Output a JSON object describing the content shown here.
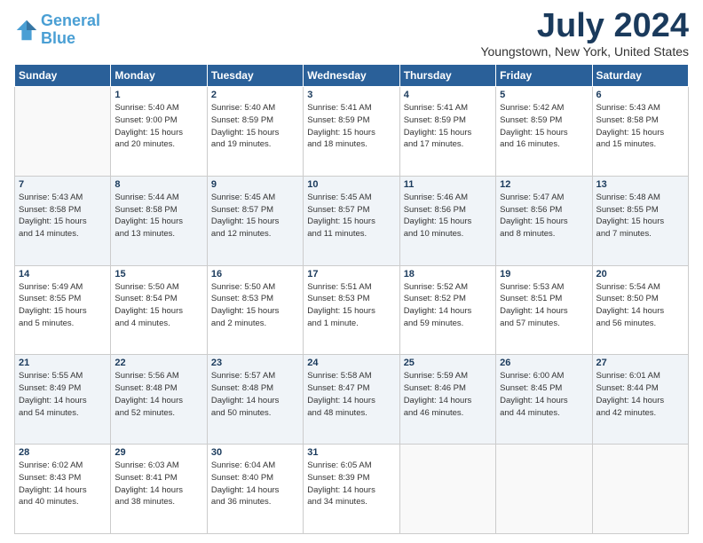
{
  "header": {
    "logo_line1": "General",
    "logo_line2": "Blue",
    "title": "July 2024",
    "location": "Youngstown, New York, United States"
  },
  "days_of_week": [
    "Sunday",
    "Monday",
    "Tuesday",
    "Wednesday",
    "Thursday",
    "Friday",
    "Saturday"
  ],
  "weeks": [
    [
      {
        "num": "",
        "info": ""
      },
      {
        "num": "1",
        "info": "Sunrise: 5:40 AM\nSunset: 9:00 PM\nDaylight: 15 hours\nand 20 minutes."
      },
      {
        "num": "2",
        "info": "Sunrise: 5:40 AM\nSunset: 8:59 PM\nDaylight: 15 hours\nand 19 minutes."
      },
      {
        "num": "3",
        "info": "Sunrise: 5:41 AM\nSunset: 8:59 PM\nDaylight: 15 hours\nand 18 minutes."
      },
      {
        "num": "4",
        "info": "Sunrise: 5:41 AM\nSunset: 8:59 PM\nDaylight: 15 hours\nand 17 minutes."
      },
      {
        "num": "5",
        "info": "Sunrise: 5:42 AM\nSunset: 8:59 PM\nDaylight: 15 hours\nand 16 minutes."
      },
      {
        "num": "6",
        "info": "Sunrise: 5:43 AM\nSunset: 8:58 PM\nDaylight: 15 hours\nand 15 minutes."
      }
    ],
    [
      {
        "num": "7",
        "info": "Sunrise: 5:43 AM\nSunset: 8:58 PM\nDaylight: 15 hours\nand 14 minutes."
      },
      {
        "num": "8",
        "info": "Sunrise: 5:44 AM\nSunset: 8:58 PM\nDaylight: 15 hours\nand 13 minutes."
      },
      {
        "num": "9",
        "info": "Sunrise: 5:45 AM\nSunset: 8:57 PM\nDaylight: 15 hours\nand 12 minutes."
      },
      {
        "num": "10",
        "info": "Sunrise: 5:45 AM\nSunset: 8:57 PM\nDaylight: 15 hours\nand 11 minutes."
      },
      {
        "num": "11",
        "info": "Sunrise: 5:46 AM\nSunset: 8:56 PM\nDaylight: 15 hours\nand 10 minutes."
      },
      {
        "num": "12",
        "info": "Sunrise: 5:47 AM\nSunset: 8:56 PM\nDaylight: 15 hours\nand 8 minutes."
      },
      {
        "num": "13",
        "info": "Sunrise: 5:48 AM\nSunset: 8:55 PM\nDaylight: 15 hours\nand 7 minutes."
      }
    ],
    [
      {
        "num": "14",
        "info": "Sunrise: 5:49 AM\nSunset: 8:55 PM\nDaylight: 15 hours\nand 5 minutes."
      },
      {
        "num": "15",
        "info": "Sunrise: 5:50 AM\nSunset: 8:54 PM\nDaylight: 15 hours\nand 4 minutes."
      },
      {
        "num": "16",
        "info": "Sunrise: 5:50 AM\nSunset: 8:53 PM\nDaylight: 15 hours\nand 2 minutes."
      },
      {
        "num": "17",
        "info": "Sunrise: 5:51 AM\nSunset: 8:53 PM\nDaylight: 15 hours\nand 1 minute."
      },
      {
        "num": "18",
        "info": "Sunrise: 5:52 AM\nSunset: 8:52 PM\nDaylight: 14 hours\nand 59 minutes."
      },
      {
        "num": "19",
        "info": "Sunrise: 5:53 AM\nSunset: 8:51 PM\nDaylight: 14 hours\nand 57 minutes."
      },
      {
        "num": "20",
        "info": "Sunrise: 5:54 AM\nSunset: 8:50 PM\nDaylight: 14 hours\nand 56 minutes."
      }
    ],
    [
      {
        "num": "21",
        "info": "Sunrise: 5:55 AM\nSunset: 8:49 PM\nDaylight: 14 hours\nand 54 minutes."
      },
      {
        "num": "22",
        "info": "Sunrise: 5:56 AM\nSunset: 8:48 PM\nDaylight: 14 hours\nand 52 minutes."
      },
      {
        "num": "23",
        "info": "Sunrise: 5:57 AM\nSunset: 8:48 PM\nDaylight: 14 hours\nand 50 minutes."
      },
      {
        "num": "24",
        "info": "Sunrise: 5:58 AM\nSunset: 8:47 PM\nDaylight: 14 hours\nand 48 minutes."
      },
      {
        "num": "25",
        "info": "Sunrise: 5:59 AM\nSunset: 8:46 PM\nDaylight: 14 hours\nand 46 minutes."
      },
      {
        "num": "26",
        "info": "Sunrise: 6:00 AM\nSunset: 8:45 PM\nDaylight: 14 hours\nand 44 minutes."
      },
      {
        "num": "27",
        "info": "Sunrise: 6:01 AM\nSunset: 8:44 PM\nDaylight: 14 hours\nand 42 minutes."
      }
    ],
    [
      {
        "num": "28",
        "info": "Sunrise: 6:02 AM\nSunset: 8:43 PM\nDaylight: 14 hours\nand 40 minutes."
      },
      {
        "num": "29",
        "info": "Sunrise: 6:03 AM\nSunset: 8:41 PM\nDaylight: 14 hours\nand 38 minutes."
      },
      {
        "num": "30",
        "info": "Sunrise: 6:04 AM\nSunset: 8:40 PM\nDaylight: 14 hours\nand 36 minutes."
      },
      {
        "num": "31",
        "info": "Sunrise: 6:05 AM\nSunset: 8:39 PM\nDaylight: 14 hours\nand 34 minutes."
      },
      {
        "num": "",
        "info": ""
      },
      {
        "num": "",
        "info": ""
      },
      {
        "num": "",
        "info": ""
      }
    ]
  ]
}
